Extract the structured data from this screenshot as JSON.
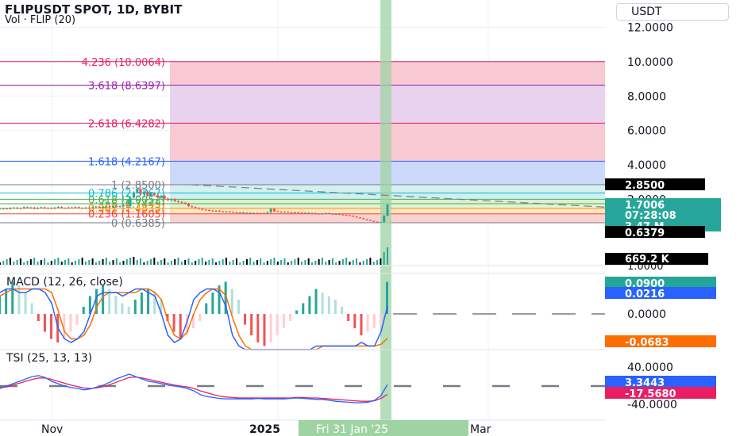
{
  "header": {
    "symbol_line": "FLIPUSDT SPOT, 1D, BYBIT",
    "volume_line": "Vol · FLIP (20)"
  },
  "currency_button": "USDT",
  "colors": {
    "grid": "#eef0f3",
    "candle_up": "#26a69a",
    "candle_down": "#ef5350",
    "highlight_band": "#9fd3a3",
    "macd_line": "#2962ff",
    "signal_line": "#ff6d00",
    "tsi_line": "#2962ff",
    "tsi_signal": "#e91e63"
  },
  "chart_data": {
    "type": "candlestick",
    "title": "FLIPUSDT SPOT, 1D, BYBIT",
    "price_axis": {
      "ticks": [
        "12.0000",
        "10.0000",
        "8.0000",
        "6.0000",
        "4.0000",
        "2.0000"
      ]
    },
    "time_axis": {
      "labels": [
        "Nov",
        "2025",
        "Mar"
      ],
      "cursor_label": "Fri 31 Jan '25"
    },
    "fib_levels": [
      {
        "ratio": "4.236",
        "price": 10.0064,
        "label": "4.236 (10.0064)",
        "color": "#e91e63",
        "fill": "#f8c9d3"
      },
      {
        "ratio": "3.618",
        "price": 8.6397,
        "label": "3.618 (8.6397)",
        "color": "#9c27b0",
        "fill": "#e9d2ee"
      },
      {
        "ratio": "2.618",
        "price": 6.4282,
        "label": "2.618 (6.4282)",
        "color": "#e91e63",
        "fill": "#f8c9d3"
      },
      {
        "ratio": "1.618",
        "price": 4.2167,
        "label": "1.618 (4.2167)",
        "color": "#2962ff",
        "fill": "#cdd9fb"
      },
      {
        "ratio": "1",
        "price": 2.85,
        "label": "1 (2.8500)",
        "color": "#787b86",
        "fill": "#d5f0ee"
      },
      {
        "ratio": "0.786",
        "price": 2.3767,
        "label": "0.786 (2.3767)",
        "color": "#00bcd4",
        "fill": "#cfeff0"
      },
      {
        "ratio": "0.618",
        "price": 2.0052,
        "label": "0.618 (2.0052)",
        "color": "#4caf50",
        "fill": "#d8f0d6"
      },
      {
        "ratio": "0.5",
        "price": 1.7443,
        "label": "0.5 (1.7443)",
        "color": "#4caf50",
        "fill": "#e3f3d6"
      },
      {
        "ratio": "0.382",
        "price": 1.4833,
        "label": "0.382 (1.4833)",
        "color": "#ff9800",
        "fill": "#fbe6c6"
      },
      {
        "ratio": "0.236",
        "price": 1.1605,
        "label": "0.236 (1.1605)",
        "color": "#f44336",
        "fill": "#fbd2d0"
      },
      {
        "ratio": "0",
        "price": 0.6385,
        "label": "0 (0.6385)",
        "color": "#787b86",
        "fill": ""
      }
    ],
    "candles_close": [
      1.45,
      1.48,
      1.44,
      1.5,
      1.52,
      1.47,
      1.49,
      1.55,
      1.5,
      1.53,
      1.46,
      1.51,
      1.54,
      1.48,
      1.5,
      1.47,
      1.52,
      1.56,
      1.5,
      1.49,
      1.53,
      1.51,
      1.55,
      1.5,
      1.48,
      1.52,
      1.5,
      1.54,
      1.58,
      1.52,
      1.56,
      1.6,
      1.55,
      1.62,
      1.58,
      1.6,
      1.65,
      1.62,
      2.1,
      2.4,
      2.6,
      2.3,
      2.45,
      2.2,
      2.35,
      2.25,
      2.1,
      2.2,
      2.05,
      1.95,
      2.0,
      1.9,
      1.85,
      1.8,
      1.75,
      1.6,
      1.55,
      1.5,
      1.45,
      1.4,
      1.38,
      1.35,
      1.32,
      1.34,
      1.3,
      1.28,
      1.3,
      1.27,
      1.25,
      1.22,
      1.24,
      1.2,
      1.22,
      1.19,
      1.21,
      1.2,
      1.18,
      1.2,
      1.25,
      1.45,
      1.3,
      1.28,
      1.25,
      1.27,
      1.24,
      1.22,
      1.25,
      1.23,
      1.2,
      1.22,
      1.18,
      1.2,
      1.17,
      1.15,
      1.18,
      1.2,
      1.16,
      1.14,
      1.15,
      1.12,
      1.1,
      1.08,
      1.05,
      1.0,
      0.95,
      0.9,
      0.85,
      0.8,
      0.75,
      0.7,
      0.66,
      0.68,
      1.05,
      1.7006
    ],
    "price_labels": [
      {
        "text": "2.8500",
        "bg": "#000000",
        "fg": "#ffffff"
      },
      {
        "text": "1.7006",
        "bg": "#26a69a",
        "fg": "#ffffff"
      },
      {
        "text": "07:28:08",
        "bg": "#26a69a",
        "fg": "#ffffff"
      },
      {
        "text": "3.47 M",
        "bg": "#26a69a",
        "fg": "#ffffff"
      },
      {
        "text": "0.6379",
        "bg": "#000000",
        "fg": "#ffffff"
      }
    ],
    "volume_label": "669.2 K",
    "volume_axis_tick": "1.0000",
    "macd": {
      "title": "MACD (12, 26, close)",
      "zero_tick": "0.0000",
      "labels": [
        {
          "text": "0.0900",
          "bg": "#26a69a",
          "fg": "#ffffff"
        },
        {
          "text": "0.0216",
          "bg": "#2962ff",
          "fg": "#ffffff"
        },
        {
          "text": "-0.0683",
          "bg": "#ff6d00",
          "fg": "#ffffff"
        }
      ],
      "histogram": [
        0.05,
        0.07,
        0.09,
        0.08,
        0.06,
        0.03,
        -0.02,
        -0.05,
        -0.07,
        -0.08,
        -0.07,
        -0.05,
        -0.03,
        0.02,
        0.05,
        0.07,
        0.08,
        0.07,
        0.05,
        0.03,
        0.02,
        0.04,
        0.06,
        0.07,
        0.06,
        0.04,
        -0.02,
        -0.05,
        -0.07,
        -0.06,
        -0.04,
        -0.02,
        0.03,
        0.06,
        0.08,
        0.09,
        0.07,
        0.04,
        -0.03,
        -0.06,
        -0.08,
        -0.09,
        -0.08,
        -0.06,
        -0.04,
        -0.02,
        0.01,
        0.03,
        0.05,
        0.07,
        0.06,
        0.05,
        0.04,
        0.02,
        -0.02,
        -0.04,
        -0.06,
        -0.05,
        -0.04,
        -0.03,
        0.09
      ],
      "macd_line": [
        0.06,
        0.07,
        0.07,
        0.06,
        0.06,
        0.07,
        0.07,
        0.06,
        0.03,
        -0.04,
        -0.07,
        -0.08,
        -0.07,
        -0.05,
        0.0,
        0.05,
        0.06,
        0.06,
        0.06,
        0.05,
        0.06,
        0.07,
        0.07,
        0.06,
        0.05,
        0.0,
        -0.06,
        -0.08,
        -0.07,
        -0.02,
        0.04,
        0.06,
        0.07,
        0.07,
        0.06,
        0.02,
        -0.06,
        -0.09,
        -0.1,
        -0.1,
        -0.1,
        -0.1,
        -0.1,
        -0.1,
        -0.1,
        -0.1,
        -0.1,
        -0.1,
        -0.1,
        -0.09,
        -0.09,
        -0.09,
        -0.09,
        -0.09,
        -0.09,
        -0.09,
        -0.08,
        -0.09,
        -0.09,
        -0.05,
        0.0216
      ],
      "signal_line": [
        0.05,
        0.06,
        0.07,
        0.07,
        0.07,
        0.07,
        0.07,
        0.07,
        0.06,
        0.01,
        -0.05,
        -0.07,
        -0.07,
        -0.06,
        -0.03,
        0.02,
        0.05,
        0.06,
        0.06,
        0.06,
        0.06,
        0.06,
        0.07,
        0.07,
        0.06,
        0.04,
        -0.02,
        -0.06,
        -0.07,
        -0.05,
        0.0,
        0.04,
        0.06,
        0.07,
        0.07,
        0.05,
        -0.01,
        -0.06,
        -0.09,
        -0.1,
        -0.1,
        -0.1,
        -0.1,
        -0.1,
        -0.1,
        -0.1,
        -0.1,
        -0.1,
        -0.1,
        -0.1,
        -0.09,
        -0.09,
        -0.09,
        -0.09,
        -0.09,
        -0.09,
        -0.09,
        -0.09,
        -0.09,
        -0.085,
        -0.0683
      ]
    },
    "tsi": {
      "title": "TSI (25, 13, 13)",
      "ticks": [
        "40.0000",
        "-40.0000"
      ],
      "labels": [
        {
          "text": "3.3443",
          "bg": "#2962ff",
          "fg": "#ffffff"
        },
        {
          "text": "-17.5680",
          "bg": "#e91e63",
          "fg": "#ffffff"
        }
      ],
      "tsi_line": [
        -5,
        0,
        5,
        10,
        15,
        20,
        22,
        18,
        10,
        5,
        0,
        -3,
        -5,
        -8,
        -6,
        -2,
        2,
        8,
        15,
        20,
        25,
        20,
        15,
        10,
        8,
        5,
        2,
        0,
        -2,
        -5,
        -10,
        -18,
        -22,
        -24,
        -26,
        -27,
        -27,
        -27,
        -27,
        -27,
        -26,
        -27,
        -27,
        -27,
        -27,
        -26,
        -25,
        -26,
        -27,
        -28,
        -28,
        -30,
        -32,
        -33,
        -34,
        -35,
        -35,
        -34,
        -30,
        -20,
        3.3443
      ],
      "signal_line": [
        -3,
        -2,
        2,
        6,
        10,
        14,
        17,
        17,
        14,
        10,
        6,
        2,
        -1,
        -4,
        -5,
        -4,
        -1,
        3,
        8,
        13,
        18,
        19,
        17,
        14,
        11,
        8,
        5,
        2,
        0,
        -2,
        -5,
        -10,
        -14,
        -18,
        -21,
        -23,
        -24,
        -25,
        -25,
        -25,
        -25,
        -25,
        -25,
        -25,
        -25,
        -25,
        -24,
        -24,
        -25,
        -25,
        -26,
        -27,
        -28,
        -29,
        -30,
        -31,
        -32,
        -32,
        -31,
        -26,
        -17.568
      ]
    }
  }
}
